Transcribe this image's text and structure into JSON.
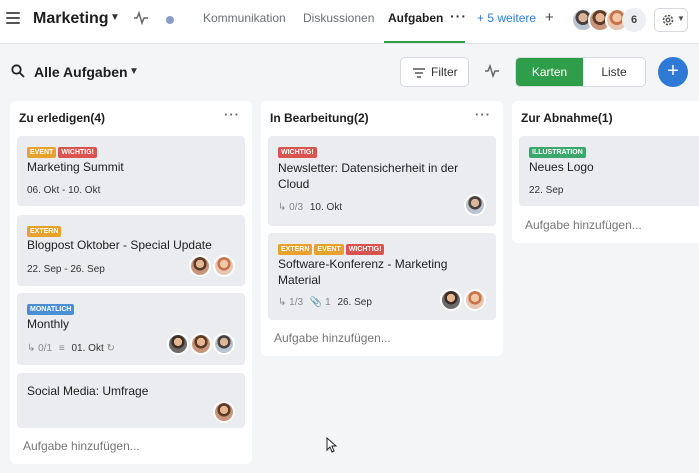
{
  "header": {
    "title": "Marketing",
    "tabs": [
      {
        "label": "Kommunikation"
      },
      {
        "label": "Diskussionen"
      },
      {
        "label": "Aufgaben"
      }
    ],
    "more_tabs": "+ 5 weitere",
    "member_count": "6"
  },
  "toolbar": {
    "view_title": "Alle Aufgaben",
    "filter_label": "Filter",
    "view_karten": "Karten",
    "view_liste": "Liste"
  },
  "colors": {
    "accent_green": "#2e9e4a",
    "accent_blue": "#2f7ad6",
    "tag_event": "#e8a22b",
    "tag_wichtig": "#d9534f",
    "tag_extern": "#e8a22b",
    "tag_monatlich": "#4a8fd6",
    "tag_illustration": "#3aa76d"
  },
  "columns": [
    {
      "title": "Zu erledigen(4)",
      "add_label": "Aufgabe hinzufügen...",
      "cards": [
        {
          "tags": [
            "EVENT",
            "WICHTIG!"
          ],
          "title": "Marketing Summit",
          "date": "06. Okt - 10. Okt"
        },
        {
          "tags": [
            "EXTERN"
          ],
          "title": "Blogpost Oktober - Special Update",
          "date": "22. Sep - 26. Sep"
        },
        {
          "tags": [
            "MONATLICH"
          ],
          "title": "Monthly",
          "subtasks": "0/1",
          "date": "01. Okt"
        },
        {
          "tags": [],
          "title": "Social Media: Umfrage"
        }
      ]
    },
    {
      "title": "In Bearbeitung(2)",
      "add_label": "Aufgabe hinzufügen...",
      "cards": [
        {
          "tags": [
            "WICHTIG!"
          ],
          "title_line1": "Newsletter: Datensicherheit in der",
          "title_line2": "Cloud",
          "subtasks": "0/3",
          "date": "10. Okt"
        },
        {
          "tags": [
            "EXTERN",
            "EVENT",
            "WICHTIG!"
          ],
          "title_line1": "Software-Konferenz - Marketing",
          "title_line2": "Material",
          "subtasks": "1/3",
          "attachments": "1",
          "date": "26. Sep"
        }
      ]
    },
    {
      "title": "Zur Abnahme(1)",
      "add_label": "Aufgabe hinzufügen...",
      "cards": [
        {
          "tags": [
            "ILLUSTRATION"
          ],
          "title": "Neues Logo",
          "date": "22. Sep"
        }
      ]
    }
  ]
}
